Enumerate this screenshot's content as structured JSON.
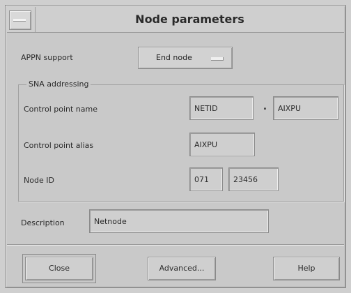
{
  "window": {
    "title": "Node parameters"
  },
  "appn": {
    "label": "APPN support",
    "value": "End node"
  },
  "sna": {
    "group_label": "SNA addressing",
    "cp_name": {
      "label": "Control point name",
      "net": "NETID",
      "separator": ".",
      "name": "AIXPU"
    },
    "cp_alias": {
      "label": "Control point alias",
      "value": "AIXPU"
    },
    "node_id": {
      "label": "Node ID",
      "block": "071",
      "id": "23456"
    }
  },
  "description": {
    "label": "Description",
    "value": "Netnode"
  },
  "buttons": {
    "close": "Close",
    "advanced": "Advanced...",
    "help": "Help"
  }
}
